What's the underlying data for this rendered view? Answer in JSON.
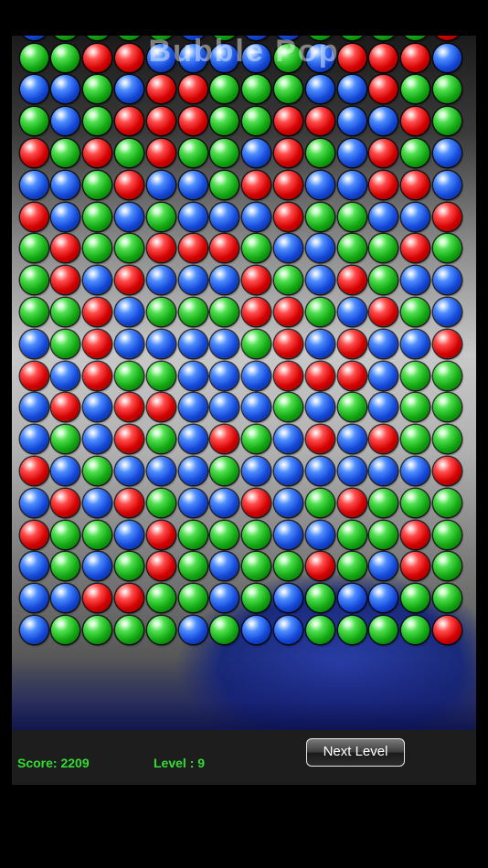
{
  "game": {
    "title": "Bubble Pop",
    "colors": {
      "red": "#d40000",
      "green": "#12a812",
      "blue": "#1448d8",
      "score_text": "#33dd33"
    },
    "rows": [
      [
        "G",
        "G",
        "R",
        "R",
        "B",
        "B",
        "B",
        "B",
        "G",
        "B",
        "R",
        "R",
        "R",
        "B"
      ],
      [
        "B",
        "B",
        "G",
        "B",
        "R",
        "R",
        "G",
        "G",
        "G",
        "B",
        "B",
        "R",
        "G",
        "G"
      ],
      [
        "G",
        "B",
        "G",
        "R",
        "R",
        "R",
        "G",
        "G",
        "R",
        "R",
        "B",
        "B",
        "R",
        "G"
      ],
      [
        "R",
        "G",
        "R",
        "G",
        "R",
        "G",
        "G",
        "B",
        "R",
        "G",
        "B",
        "R",
        "G",
        "B"
      ],
      [
        "B",
        "B",
        "G",
        "R",
        "B",
        "B",
        "G",
        "R",
        "R",
        "B",
        "B",
        "R",
        "R",
        "B"
      ],
      [
        "R",
        "B",
        "G",
        "B",
        "G",
        "B",
        "B",
        "B",
        "R",
        "G",
        "G",
        "B",
        "B",
        "R"
      ],
      [
        "G",
        "R",
        "G",
        "G",
        "R",
        "R",
        "R",
        "G",
        "B",
        "B",
        "G",
        "G",
        "R",
        "G"
      ],
      [
        "G",
        "R",
        "B",
        "R",
        "B",
        "B",
        "B",
        "R",
        "G",
        "B",
        "R",
        "G",
        "B",
        "B"
      ],
      [
        "G",
        "G",
        "R",
        "B",
        "G",
        "G",
        "G",
        "R",
        "R",
        "G",
        "B",
        "R",
        "G",
        "B"
      ],
      [
        "B",
        "G",
        "R",
        "B",
        "B",
        "B",
        "B",
        "G",
        "R",
        "B",
        "R",
        "B",
        "B",
        "R"
      ],
      [
        "R",
        "B",
        "R",
        "G",
        "G",
        "B",
        "B",
        "B",
        "R",
        "R",
        "R",
        "B",
        "G",
        "G"
      ],
      [
        "B",
        "R",
        "B",
        "R",
        "R",
        "B",
        "B",
        "B",
        "G",
        "B",
        "G",
        "B",
        "G",
        "G"
      ],
      [
        "B",
        "G",
        "B",
        "R",
        "G",
        "B",
        "R",
        "G",
        "B",
        "R",
        "B",
        "R",
        "G",
        "G"
      ],
      [
        "R",
        "B",
        "G",
        "B",
        "B",
        "B",
        "G",
        "B",
        "B",
        "B",
        "B",
        "B",
        "B",
        "R"
      ],
      [
        "B",
        "R",
        "B",
        "R",
        "G",
        "B",
        "B",
        "R",
        "B",
        "G",
        "R",
        "G",
        "G",
        "G"
      ],
      [
        "R",
        "G",
        "G",
        "B",
        "R",
        "G",
        "G",
        "G",
        "B",
        "B",
        "G",
        "G",
        "R",
        "G"
      ],
      [
        "B",
        "G",
        "B",
        "G",
        "R",
        "G",
        "B",
        "G",
        "G",
        "R",
        "G",
        "B",
        "R",
        "G"
      ],
      [
        "B",
        "B",
        "R",
        "R",
        "G",
        "G",
        "B",
        "G",
        "B",
        "G",
        "B",
        "B",
        "G",
        "G"
      ],
      [
        "B",
        "G",
        "G",
        "G",
        "G",
        "B",
        "G",
        "B",
        "B",
        "G",
        "G",
        "G",
        "G",
        "R"
      ]
    ]
  },
  "status": {
    "score_label": "Score: 2209",
    "level_label": "Level : 9"
  },
  "controls": {
    "next_level_label": "Next Level"
  }
}
